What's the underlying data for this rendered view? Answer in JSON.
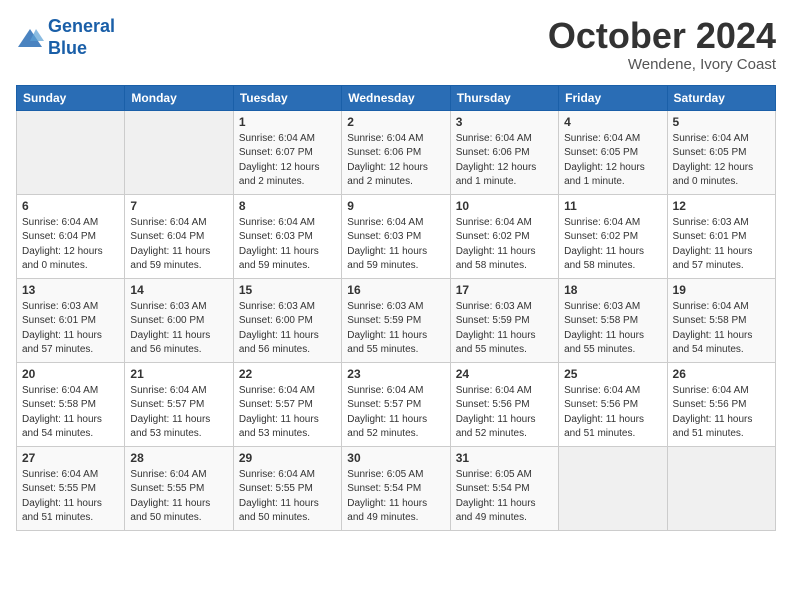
{
  "header": {
    "logo_line1": "General",
    "logo_line2": "Blue",
    "month_title": "October 2024",
    "subtitle": "Wendene, Ivory Coast"
  },
  "weekdays": [
    "Sunday",
    "Monday",
    "Tuesday",
    "Wednesday",
    "Thursday",
    "Friday",
    "Saturday"
  ],
  "weeks": [
    [
      {
        "day": "",
        "info": ""
      },
      {
        "day": "",
        "info": ""
      },
      {
        "day": "1",
        "info": "Sunrise: 6:04 AM\nSunset: 6:07 PM\nDaylight: 12 hours\nand 2 minutes."
      },
      {
        "day": "2",
        "info": "Sunrise: 6:04 AM\nSunset: 6:06 PM\nDaylight: 12 hours\nand 2 minutes."
      },
      {
        "day": "3",
        "info": "Sunrise: 6:04 AM\nSunset: 6:06 PM\nDaylight: 12 hours\nand 1 minute."
      },
      {
        "day": "4",
        "info": "Sunrise: 6:04 AM\nSunset: 6:05 PM\nDaylight: 12 hours\nand 1 minute."
      },
      {
        "day": "5",
        "info": "Sunrise: 6:04 AM\nSunset: 6:05 PM\nDaylight: 12 hours\nand 0 minutes."
      }
    ],
    [
      {
        "day": "6",
        "info": "Sunrise: 6:04 AM\nSunset: 6:04 PM\nDaylight: 12 hours\nand 0 minutes."
      },
      {
        "day": "7",
        "info": "Sunrise: 6:04 AM\nSunset: 6:04 PM\nDaylight: 11 hours\nand 59 minutes."
      },
      {
        "day": "8",
        "info": "Sunrise: 6:04 AM\nSunset: 6:03 PM\nDaylight: 11 hours\nand 59 minutes."
      },
      {
        "day": "9",
        "info": "Sunrise: 6:04 AM\nSunset: 6:03 PM\nDaylight: 11 hours\nand 59 minutes."
      },
      {
        "day": "10",
        "info": "Sunrise: 6:04 AM\nSunset: 6:02 PM\nDaylight: 11 hours\nand 58 minutes."
      },
      {
        "day": "11",
        "info": "Sunrise: 6:04 AM\nSunset: 6:02 PM\nDaylight: 11 hours\nand 58 minutes."
      },
      {
        "day": "12",
        "info": "Sunrise: 6:03 AM\nSunset: 6:01 PM\nDaylight: 11 hours\nand 57 minutes."
      }
    ],
    [
      {
        "day": "13",
        "info": "Sunrise: 6:03 AM\nSunset: 6:01 PM\nDaylight: 11 hours\nand 57 minutes."
      },
      {
        "day": "14",
        "info": "Sunrise: 6:03 AM\nSunset: 6:00 PM\nDaylight: 11 hours\nand 56 minutes."
      },
      {
        "day": "15",
        "info": "Sunrise: 6:03 AM\nSunset: 6:00 PM\nDaylight: 11 hours\nand 56 minutes."
      },
      {
        "day": "16",
        "info": "Sunrise: 6:03 AM\nSunset: 5:59 PM\nDaylight: 11 hours\nand 55 minutes."
      },
      {
        "day": "17",
        "info": "Sunrise: 6:03 AM\nSunset: 5:59 PM\nDaylight: 11 hours\nand 55 minutes."
      },
      {
        "day": "18",
        "info": "Sunrise: 6:03 AM\nSunset: 5:58 PM\nDaylight: 11 hours\nand 55 minutes."
      },
      {
        "day": "19",
        "info": "Sunrise: 6:04 AM\nSunset: 5:58 PM\nDaylight: 11 hours\nand 54 minutes."
      }
    ],
    [
      {
        "day": "20",
        "info": "Sunrise: 6:04 AM\nSunset: 5:58 PM\nDaylight: 11 hours\nand 54 minutes."
      },
      {
        "day": "21",
        "info": "Sunrise: 6:04 AM\nSunset: 5:57 PM\nDaylight: 11 hours\nand 53 minutes."
      },
      {
        "day": "22",
        "info": "Sunrise: 6:04 AM\nSunset: 5:57 PM\nDaylight: 11 hours\nand 53 minutes."
      },
      {
        "day": "23",
        "info": "Sunrise: 6:04 AM\nSunset: 5:57 PM\nDaylight: 11 hours\nand 52 minutes."
      },
      {
        "day": "24",
        "info": "Sunrise: 6:04 AM\nSunset: 5:56 PM\nDaylight: 11 hours\nand 52 minutes."
      },
      {
        "day": "25",
        "info": "Sunrise: 6:04 AM\nSunset: 5:56 PM\nDaylight: 11 hours\nand 51 minutes."
      },
      {
        "day": "26",
        "info": "Sunrise: 6:04 AM\nSunset: 5:56 PM\nDaylight: 11 hours\nand 51 minutes."
      }
    ],
    [
      {
        "day": "27",
        "info": "Sunrise: 6:04 AM\nSunset: 5:55 PM\nDaylight: 11 hours\nand 51 minutes."
      },
      {
        "day": "28",
        "info": "Sunrise: 6:04 AM\nSunset: 5:55 PM\nDaylight: 11 hours\nand 50 minutes."
      },
      {
        "day": "29",
        "info": "Sunrise: 6:04 AM\nSunset: 5:55 PM\nDaylight: 11 hours\nand 50 minutes."
      },
      {
        "day": "30",
        "info": "Sunrise: 6:05 AM\nSunset: 5:54 PM\nDaylight: 11 hours\nand 49 minutes."
      },
      {
        "day": "31",
        "info": "Sunrise: 6:05 AM\nSunset: 5:54 PM\nDaylight: 11 hours\nand 49 minutes."
      },
      {
        "day": "",
        "info": ""
      },
      {
        "day": "",
        "info": ""
      }
    ]
  ]
}
